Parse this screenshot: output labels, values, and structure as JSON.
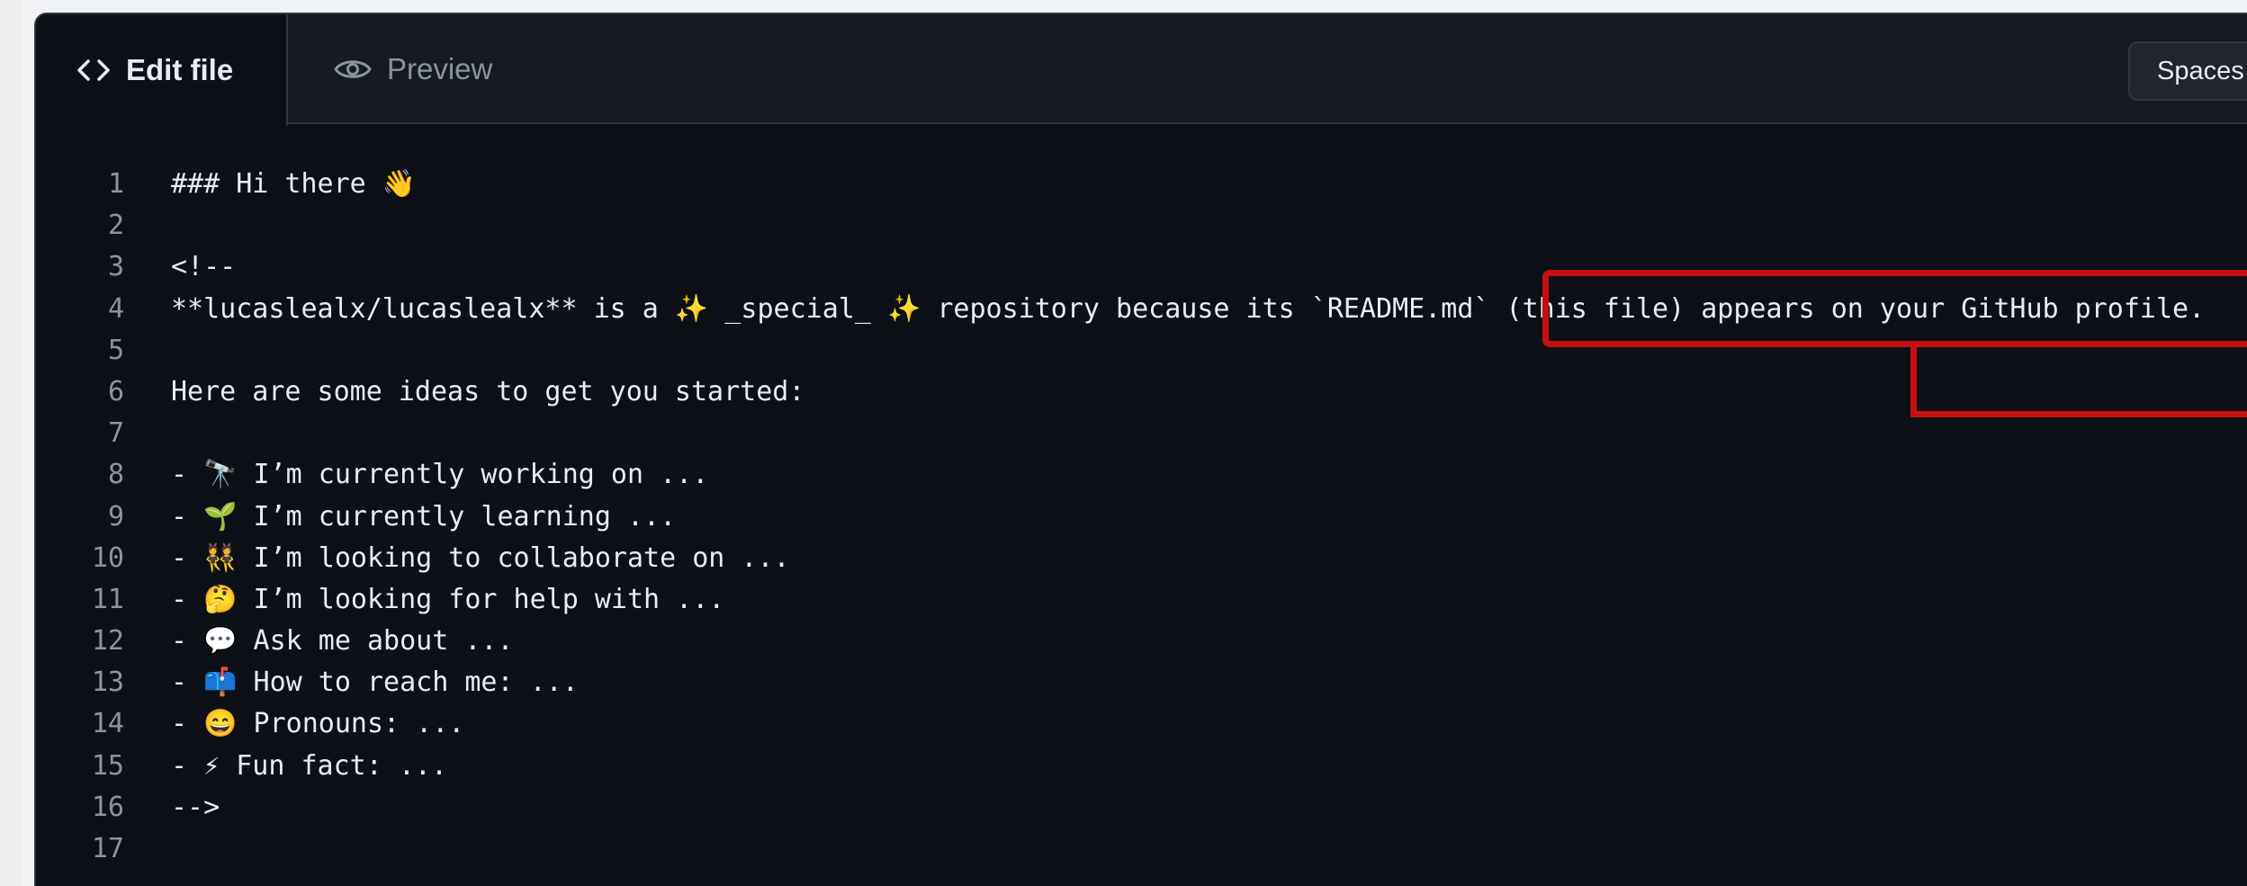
{
  "tabs": {
    "edit_label": "Edit file",
    "preview_label": "Preview"
  },
  "toolbar": {
    "spaces_label": "Spaces"
  },
  "editor": {
    "lines": [
      {
        "number": "1",
        "text": "### Hi there 👋"
      },
      {
        "number": "2",
        "text": ""
      },
      {
        "number": "3",
        "text": "<!--"
      },
      {
        "number": "4",
        "text": "**lucaslealx/lucaslealx** is a ✨ _special_ ✨ repository because its `README.md` (this file) appears on your GitHub profile."
      },
      {
        "number": "5",
        "text": ""
      },
      {
        "number": "6",
        "text": "Here are some ideas to get you started:"
      },
      {
        "number": "7",
        "text": ""
      },
      {
        "number": "8",
        "text": "- 🔭 I’m currently working on ..."
      },
      {
        "number": "9",
        "text": "- 🌱 I’m currently learning ..."
      },
      {
        "number": "10",
        "text": "- 👯 I’m looking to collaborate on ..."
      },
      {
        "number": "11",
        "text": "- 🤔 I’m looking for help with ..."
      },
      {
        "number": "12",
        "text": "- 💬 Ask me about ..."
      },
      {
        "number": "13",
        "text": "- 📫 How to reach me: ..."
      },
      {
        "number": "14",
        "text": "- 😄 Pronouns: ..."
      },
      {
        "number": "15",
        "text": "- ⚡ Fun fact: ..."
      },
      {
        "number": "16",
        "text": "-->"
      },
      {
        "number": "17",
        "text": ""
      }
    ]
  },
  "colors": {
    "editor_background": "#0d1117",
    "tabbar_background": "#161b22",
    "text": "#e6edf3",
    "muted": "#8b949e",
    "highlight": "#c30f0f"
  }
}
